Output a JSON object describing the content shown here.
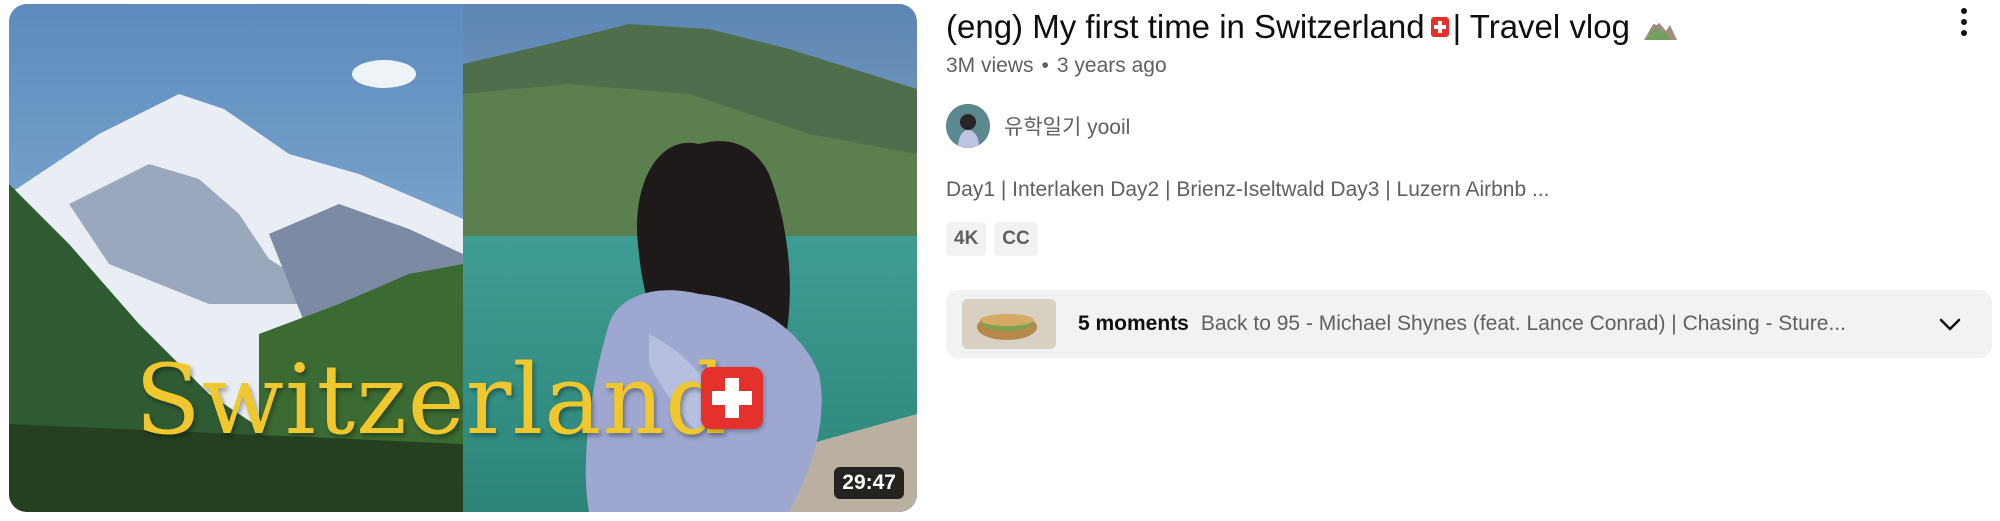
{
  "video": {
    "thumbnail_text": "Switzerland",
    "duration": "29:47",
    "title_part1": "(eng) My first time in Switzerland",
    "title_part2": "| Travel vlog",
    "views": "3M views",
    "age": "3 years ago",
    "channel_name": "유학일기 yooil",
    "description": "Day1 | Interlaken Day2 | Brienz-Iseltwald Day3 | Luzern Airbnb ...",
    "badges": [
      "4K",
      "CC"
    ],
    "moments_count": "5 moments",
    "moments_text": "Back to 95 - Michael Shynes (feat. Lance Conrad) | Chasing - Sture..."
  },
  "icons": {
    "more": "more-vert-icon",
    "expand": "chevron-down-icon",
    "flag": "swiss-flag-icon",
    "mountain": "snow-capped-mountain-icon"
  },
  "colors": {
    "flag_red": "#e5312b",
    "title_gold": "#f0c72c",
    "secondary_text": "#606060",
    "chip_bg": "#f2f2f2"
  }
}
